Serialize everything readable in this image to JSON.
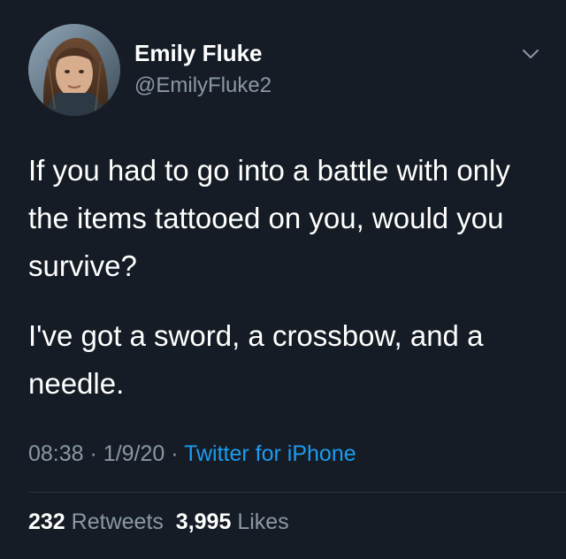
{
  "user": {
    "name": "Emily Fluke",
    "handle": "@EmilyFluke2"
  },
  "tweet": {
    "paragraphs": [
      "If you had to go into a battle with only the items tattooed on you, would you survive?",
      "I've got a sword, a crossbow, and a needle."
    ],
    "time": "08:38",
    "date": "1/9/20",
    "separator": "·",
    "source": "Twitter for iPhone"
  },
  "stats": {
    "retweets_count": "232",
    "retweets_label": "Retweets",
    "likes_count": "3,995",
    "likes_label": "Likes"
  },
  "icons": {
    "menu": "chevron-down-icon"
  },
  "colors": {
    "background": "#151c25",
    "primary_text": "#ffffff",
    "secondary_text": "#8a98a5",
    "link": "#1d9bf0"
  }
}
